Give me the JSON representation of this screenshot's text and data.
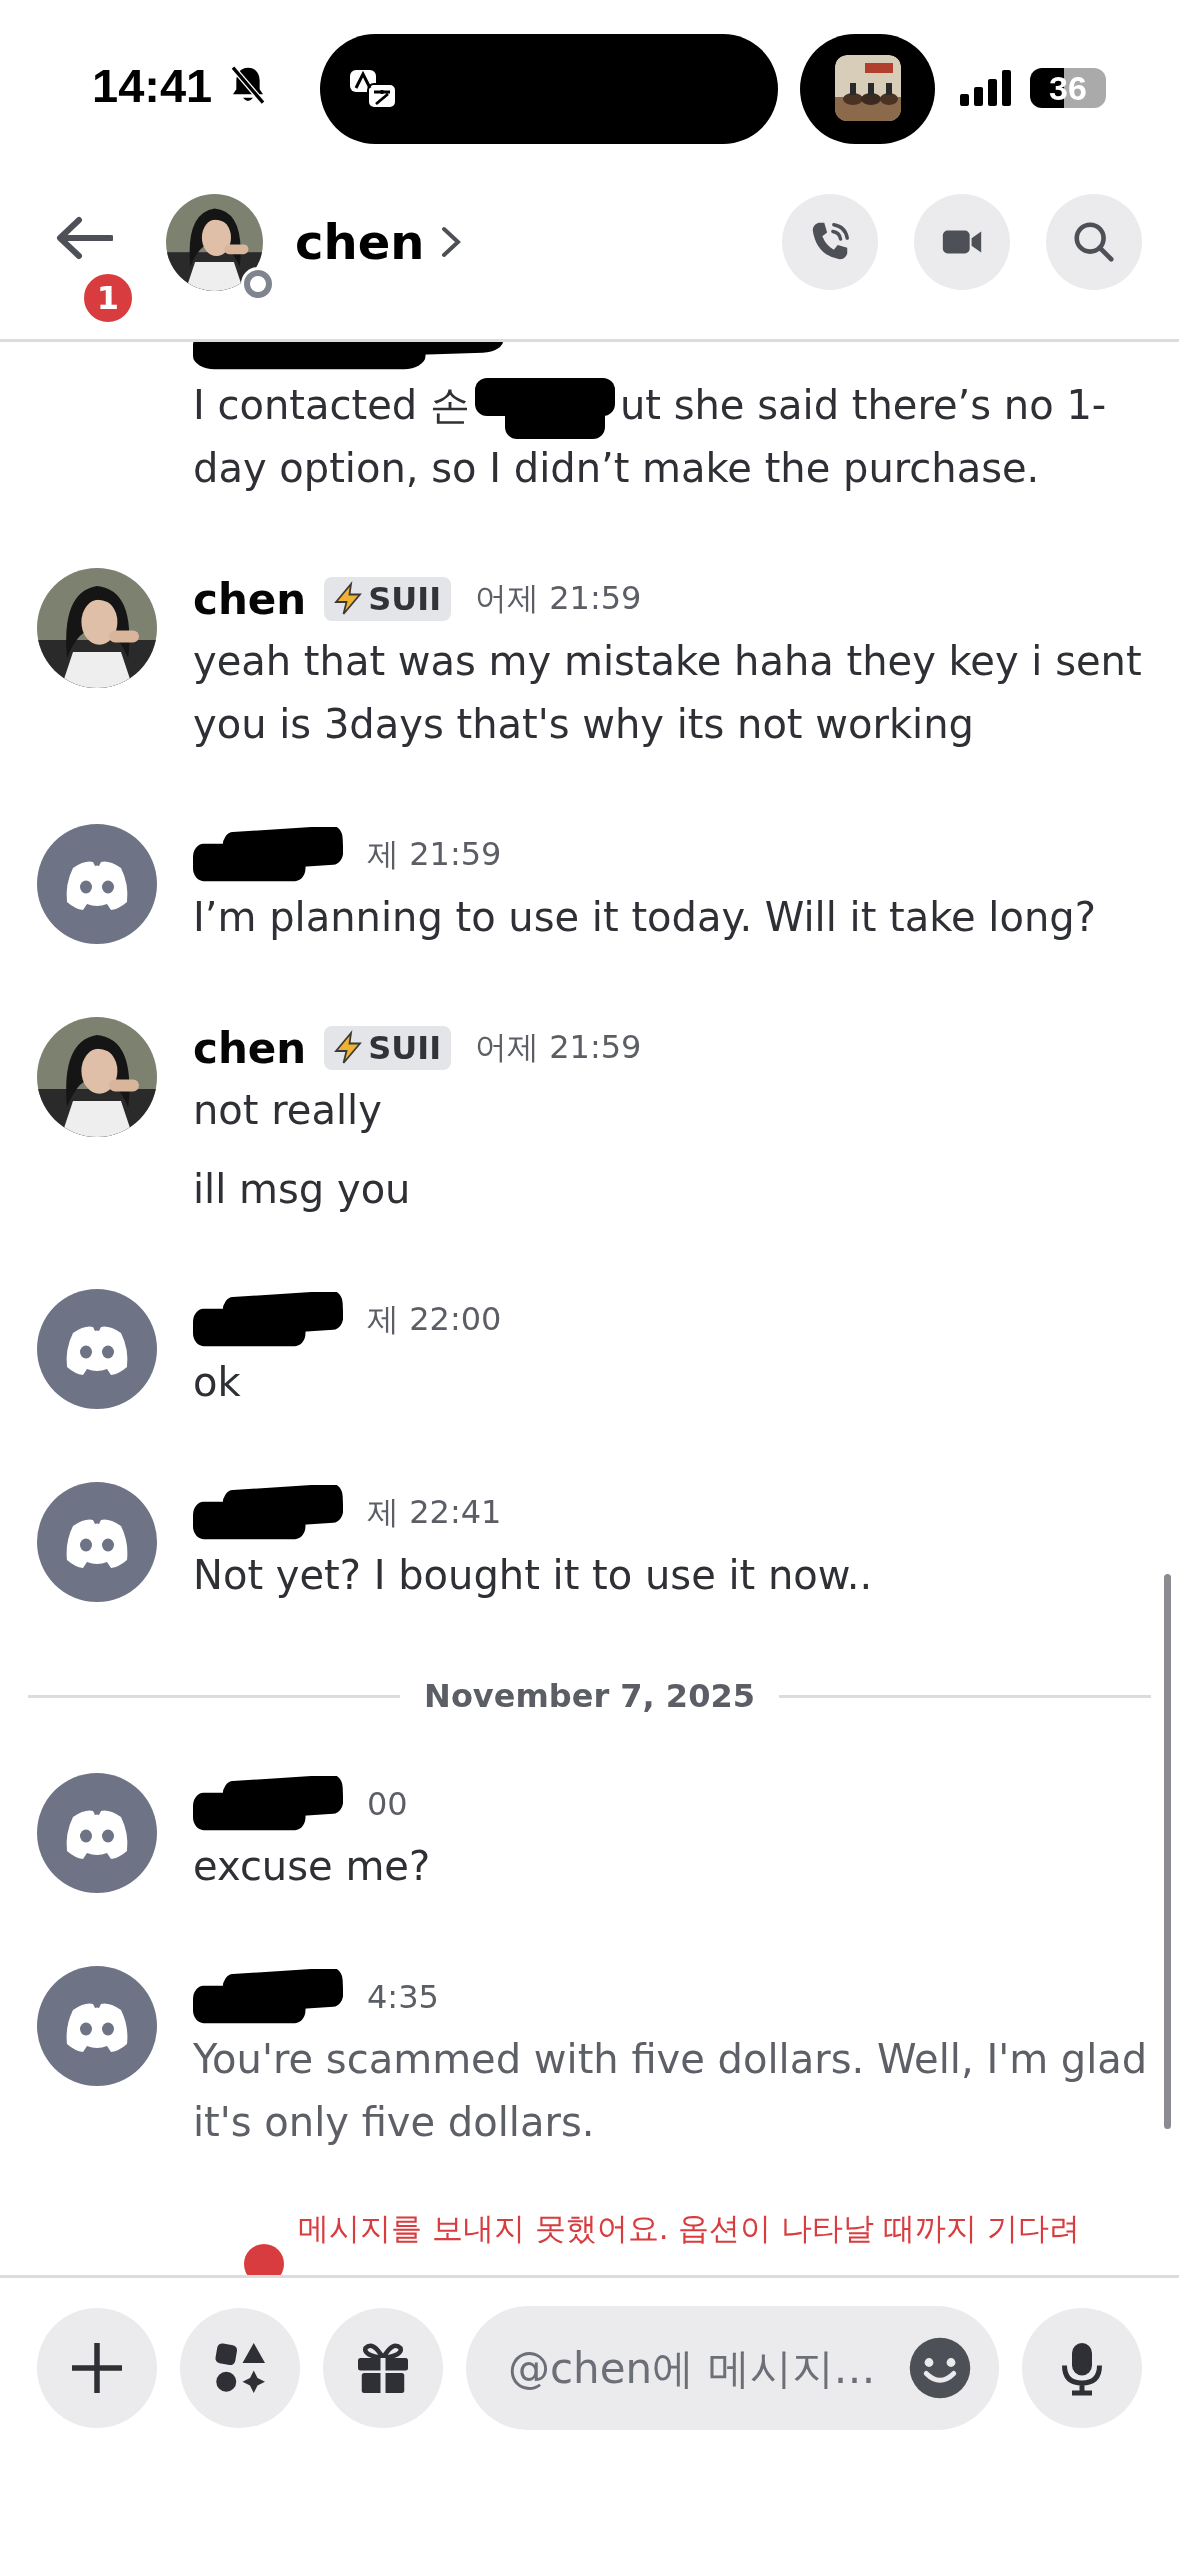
{
  "status_bar": {
    "time": "14:41",
    "battery": "36"
  },
  "header": {
    "title": "chen",
    "unread_badge": "1"
  },
  "messages": [
    {
      "kind": "cut",
      "author_redacted": true,
      "pending": false,
      "texts": [
        {
          "parts": [
            "I contacted 손",
            "ut she said there’s no 1-day option, so I didn’t make the purchase."
          ]
        }
      ]
    },
    {
      "kind": "member",
      "author": "chen",
      "badge": "SUII",
      "time": "어제 21:59",
      "pending": false,
      "texts": [
        {
          "parts": [
            "yeah that was my mistake haha they key i sent you is 3days that's why its not working"
          ]
        }
      ]
    },
    {
      "kind": "guest",
      "author_redacted": true,
      "time": "제 21:59",
      "pending": false,
      "texts": [
        {
          "parts": [
            "I’m planning to use it today. Will it take long?"
          ]
        }
      ]
    },
    {
      "kind": "member",
      "author": "chen",
      "badge": "SUII",
      "time": "어제 21:59",
      "pending": false,
      "texts": [
        {
          "parts": [
            "not really"
          ]
        },
        {
          "parts": [
            "ill msg you"
          ]
        }
      ]
    },
    {
      "kind": "guest",
      "author_redacted": true,
      "time": "제 22:00",
      "pending": false,
      "texts": [
        {
          "parts": [
            "ok"
          ]
        }
      ]
    },
    {
      "kind": "guest",
      "author_redacted": true,
      "time": "제 22:41",
      "pending": false,
      "texts": [
        {
          "parts": [
            "Not yet? I bought it to use it now.."
          ]
        }
      ]
    },
    {
      "kind": "divider",
      "label": "November 7, 2025"
    },
    {
      "kind": "guest",
      "author_redacted": true,
      "time": "00",
      "pending": false,
      "texts": [
        {
          "parts": [
            "excuse me?"
          ]
        }
      ]
    },
    {
      "kind": "guest",
      "author_redacted": true,
      "time": "4:35",
      "pending": true,
      "texts": [
        {
          "parts": [
            "You're scammed with five dollars. Well, I'm glad it's only five dollars."
          ]
        }
      ]
    }
  ],
  "error": "메시지를 보내지 못했어요. 옵션이 나타날 때까지 기다려",
  "composer": {
    "placeholder": "@chen에 메시지…"
  }
}
